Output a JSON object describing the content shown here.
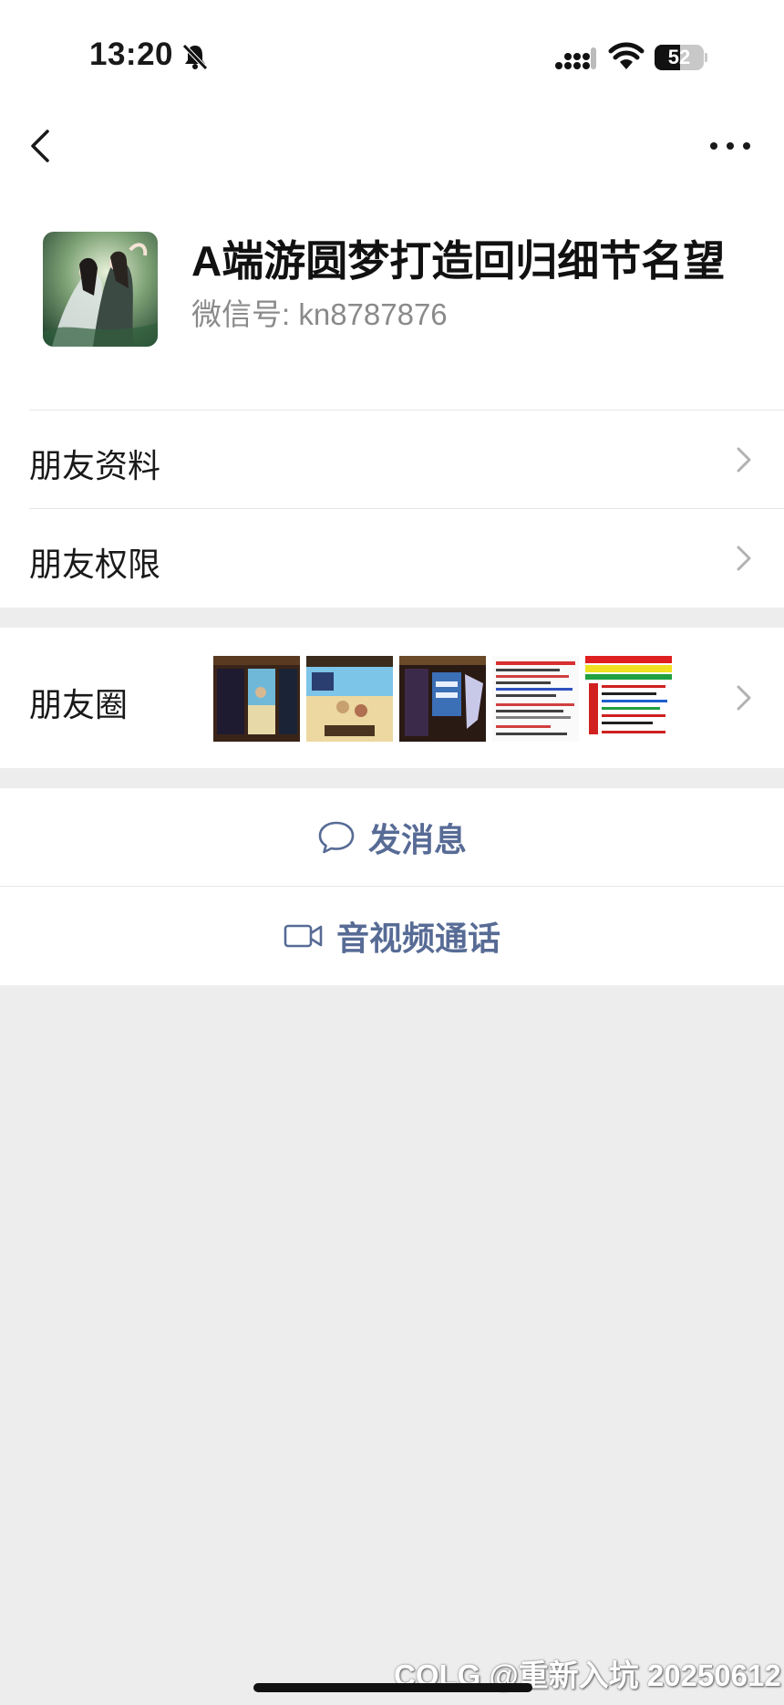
{
  "status_bar": {
    "time": "13:20",
    "battery": "52",
    "battery_level": 0.52
  },
  "profile": {
    "name": "A端游圆梦打造回归细节名望",
    "wechat_id": "微信号: kn8787876"
  },
  "menu": {
    "friend_info": "朋友资料",
    "friend_permissions": "朋友权限",
    "moments": "朋友圈"
  },
  "actions": {
    "send_message": "发消息",
    "av_call": "音视频通话"
  },
  "watermark": "COLG @重新入坑 20250612",
  "colors": {
    "link": "#576b95",
    "background": "#ededed"
  }
}
